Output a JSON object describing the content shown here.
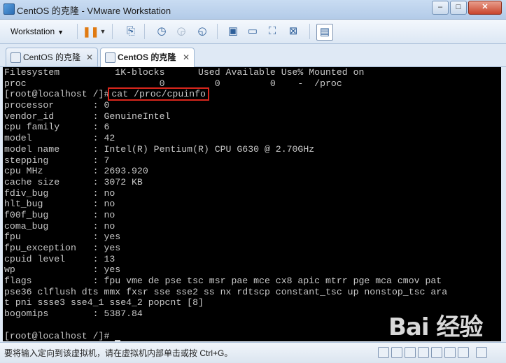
{
  "window": {
    "title": "CentOS 的克隆 - VMware Workstation",
    "controls": {
      "minimize": "–",
      "maximize": "□",
      "close": "✕"
    }
  },
  "toolbar": {
    "workstation_menu": "Workstation",
    "icons": [
      "pause-icon",
      "send-ctrl-alt-del-icon",
      "snapshot-icon",
      "revert-snapshot-icon",
      "snapshot-manager-icon",
      "console-view-icon",
      "quick-switch-icon",
      "fullscreen-icon",
      "unity-icon",
      "thumbnail-icon"
    ]
  },
  "tabs": [
    {
      "label": "CentOS 的克隆",
      "active": false,
      "close": "✕"
    },
    {
      "label": "CentOS 的克隆",
      "active": true,
      "close": "✕"
    }
  ],
  "console": {
    "lines": [
      "Filesystem          1K-blocks      Used Available Use% Mounted on",
      "proc                        0         0         0    -  /proc",
      "[root@localhost /]#",
      "processor       : 0",
      "vendor_id       : GenuineIntel",
      "cpu family      : 6",
      "model           : 42",
      "model name      : Intel(R) Pentium(R) CPU G630 @ 2.70GHz",
      "stepping        : 7",
      "cpu MHz         : 2693.920",
      "cache size      : 3072 KB",
      "fdiv_bug        : no",
      "hlt_bug         : no",
      "f00f_bug        : no",
      "coma_bug        : no",
      "fpu             : yes",
      "fpu_exception   : yes",
      "cpuid level     : 13",
      "wp              : yes",
      "flags           : fpu vme de pse tsc msr pae mce cx8 apic mtrr pge mca cmov pat",
      "pse36 clflush dts mmx fxsr sse sse2 ss nx rdtscp constant_tsc up nonstop_tsc ara",
      "t pni ssse3 sse4_1 sse4_2 popcnt [8]",
      "bogomips        : 5387.84",
      "",
      "[root@localhost /]# "
    ],
    "highlighted_command": "cat /proc/cpuinfo",
    "highlight_color": "#d9261c"
  },
  "statusbar": {
    "text": "要将输入定向到该虚拟机，请在虚拟机内部单击或按 Ctrl+G。"
  },
  "watermark": {
    "text": "Bai 经验"
  }
}
